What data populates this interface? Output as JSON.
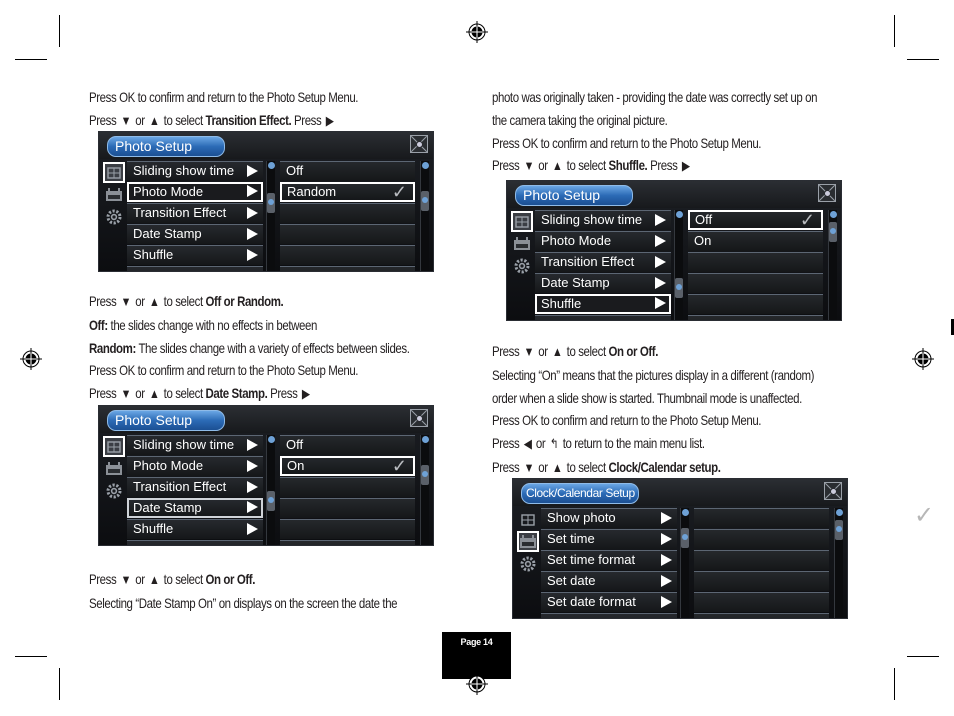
{
  "page": {
    "page_label": "Page 14"
  },
  "left_column": {
    "lines_1": [
      {
        "parts": [
          {
            "t": "Press OK to confirm and return to the Photo Setup Menu.",
            "b": false
          }
        ]
      },
      {
        "parts": [
          {
            "t": "Press ",
            "b": false
          },
          {
            "icon": "down"
          },
          {
            "t": " or ",
            "b": false
          },
          {
            "icon": "up"
          },
          {
            "t": " to select ",
            "b": false
          },
          {
            "t": "Transition Effect.",
            "b": true
          },
          {
            "t": " Press ",
            "b": false
          },
          {
            "icon": "right"
          }
        ]
      }
    ],
    "lines_2": [
      {
        "parts": [
          {
            "t": "Press ",
            "b": false
          },
          {
            "icon": "down"
          },
          {
            "t": " or ",
            "b": false
          },
          {
            "icon": "up"
          },
          {
            "t": " to select ",
            "b": false
          },
          {
            "t": "Off or Random.",
            "b": true
          }
        ]
      },
      {
        "parts": [
          {
            "t": "Off:",
            "b": true
          },
          {
            "t": " the slides change with no effects in between",
            "b": false
          }
        ]
      },
      {
        "parts": [
          {
            "t": "Random:",
            "b": true
          },
          {
            "t": " The slides change with a variety of effects between slides.",
            "b": false
          }
        ]
      },
      {
        "parts": [
          {
            "t": "Press OK to confirm and return to the Photo Setup Menu.",
            "b": false
          }
        ]
      },
      {
        "parts": [
          {
            "t": "Press ",
            "b": false
          },
          {
            "icon": "down"
          },
          {
            "t": " or ",
            "b": false
          },
          {
            "icon": "up"
          },
          {
            "t": " to select ",
            "b": false
          },
          {
            "t": "Date Stamp.",
            "b": true
          },
          {
            "t": " Press ",
            "b": false
          },
          {
            "icon": "right"
          }
        ]
      }
    ],
    "lines_3": [
      {
        "parts": [
          {
            "t": "Press ",
            "b": false
          },
          {
            "icon": "down"
          },
          {
            "t": " or ",
            "b": false
          },
          {
            "icon": "up"
          },
          {
            "t": " to select ",
            "b": false
          },
          {
            "t": "On or Off.",
            "b": true
          }
        ]
      },
      {
        "parts": [
          {
            "t": "Selecting “Date Stamp On” on displays on the screen the date the",
            "b": false
          }
        ]
      }
    ]
  },
  "right_column": {
    "lines_1": [
      {
        "parts": [
          {
            "t": "photo was originally taken - providing the date was correctly set up on",
            "b": false
          }
        ]
      },
      {
        "parts": [
          {
            "t": "the camera taking the original picture.",
            "b": false
          }
        ]
      },
      {
        "parts": [
          {
            "t": "Press OK to confirm and return to the Photo Setup Menu.",
            "b": false
          }
        ]
      },
      {
        "parts": [
          {
            "t": "Press ",
            "b": false
          },
          {
            "icon": "down"
          },
          {
            "t": " or ",
            "b": false
          },
          {
            "icon": "up"
          },
          {
            "t": " to select ",
            "b": false
          },
          {
            "t": "Shuffle.",
            "b": true
          },
          {
            "t": " Press ",
            "b": false
          },
          {
            "icon": "right"
          }
        ]
      }
    ],
    "lines_2": [
      {
        "parts": [
          {
            "t": "Press ",
            "b": false
          },
          {
            "icon": "down"
          },
          {
            "t": " or ",
            "b": false
          },
          {
            "icon": "up"
          },
          {
            "t": " to select ",
            "b": false
          },
          {
            "t": "On or Off.",
            "b": true
          }
        ]
      },
      {
        "parts": [
          {
            "t": "Selecting “On” means that the pictures display in a different (random)",
            "b": false
          }
        ]
      },
      {
        "parts": [
          {
            "t": "order when a slide show is started. Thumbnail mode is unaffected.",
            "b": false
          }
        ]
      },
      {
        "parts": [
          {
            "t": "Press OK to confirm and return to the Photo Setup Menu.",
            "b": false
          }
        ]
      },
      {
        "parts": [
          {
            "t": "Press ",
            "b": false
          },
          {
            "icon": "left"
          },
          {
            "t": " or ",
            "b": false
          },
          {
            "icon": "back"
          },
          {
            "t": " to return to the main menu list.",
            "b": false
          }
        ]
      },
      {
        "parts": [
          {
            "t": "Press ",
            "b": false
          },
          {
            "icon": "down"
          },
          {
            "t": " or ",
            "b": false
          },
          {
            "icon": "up"
          },
          {
            "t": " to select ",
            "b": false
          },
          {
            "t": "Clock/Calendar setup.",
            "b": true
          }
        ]
      }
    ]
  },
  "screens": {
    "transition": {
      "title": "Photo Setup",
      "selected_icon": 0,
      "menu": [
        "Sliding show time",
        "Photo Mode",
        "Transition Effect",
        "Date Stamp",
        "Shuffle"
      ],
      "menu_selected": 1,
      "menu_selected_style": "selected",
      "options": [
        "Off",
        "Random",
        "",
        "",
        ""
      ],
      "option_selected": 1
    },
    "date_stamp": {
      "title": "Photo Setup",
      "selected_icon": 0,
      "menu": [
        "Sliding show time",
        "Photo Mode",
        "Transition Effect",
        "Date Stamp",
        "Shuffle"
      ],
      "menu_selected": 3,
      "menu_selected_style": "dim-sel",
      "options": [
        "Off",
        "On",
        "",
        "",
        ""
      ],
      "option_selected": 1
    },
    "shuffle": {
      "title": "Photo Setup",
      "selected_icon": 0,
      "menu": [
        "Sliding show time",
        "Photo Mode",
        "Transition Effect",
        "Date Stamp",
        "Shuffle"
      ],
      "menu_selected": 4,
      "menu_selected_style": "selected",
      "options": [
        "Off",
        "On",
        "",
        "",
        ""
      ],
      "option_selected": 0
    },
    "clock": {
      "title": "Clock/Calendar Setup",
      "selected_icon": 1,
      "menu": [
        "Show photo",
        "Set time",
        "Set time format",
        "Set date",
        "Set date format"
      ],
      "menu_selected": -1,
      "menu_selected_style": "selected",
      "options": [
        "",
        "",
        "",
        "",
        ""
      ],
      "option_selected": -1
    }
  },
  "icons": {
    "side": [
      "photo-setup-icon",
      "clock-calendar-icon",
      "settings-gear-icon"
    ],
    "check": "✓"
  }
}
